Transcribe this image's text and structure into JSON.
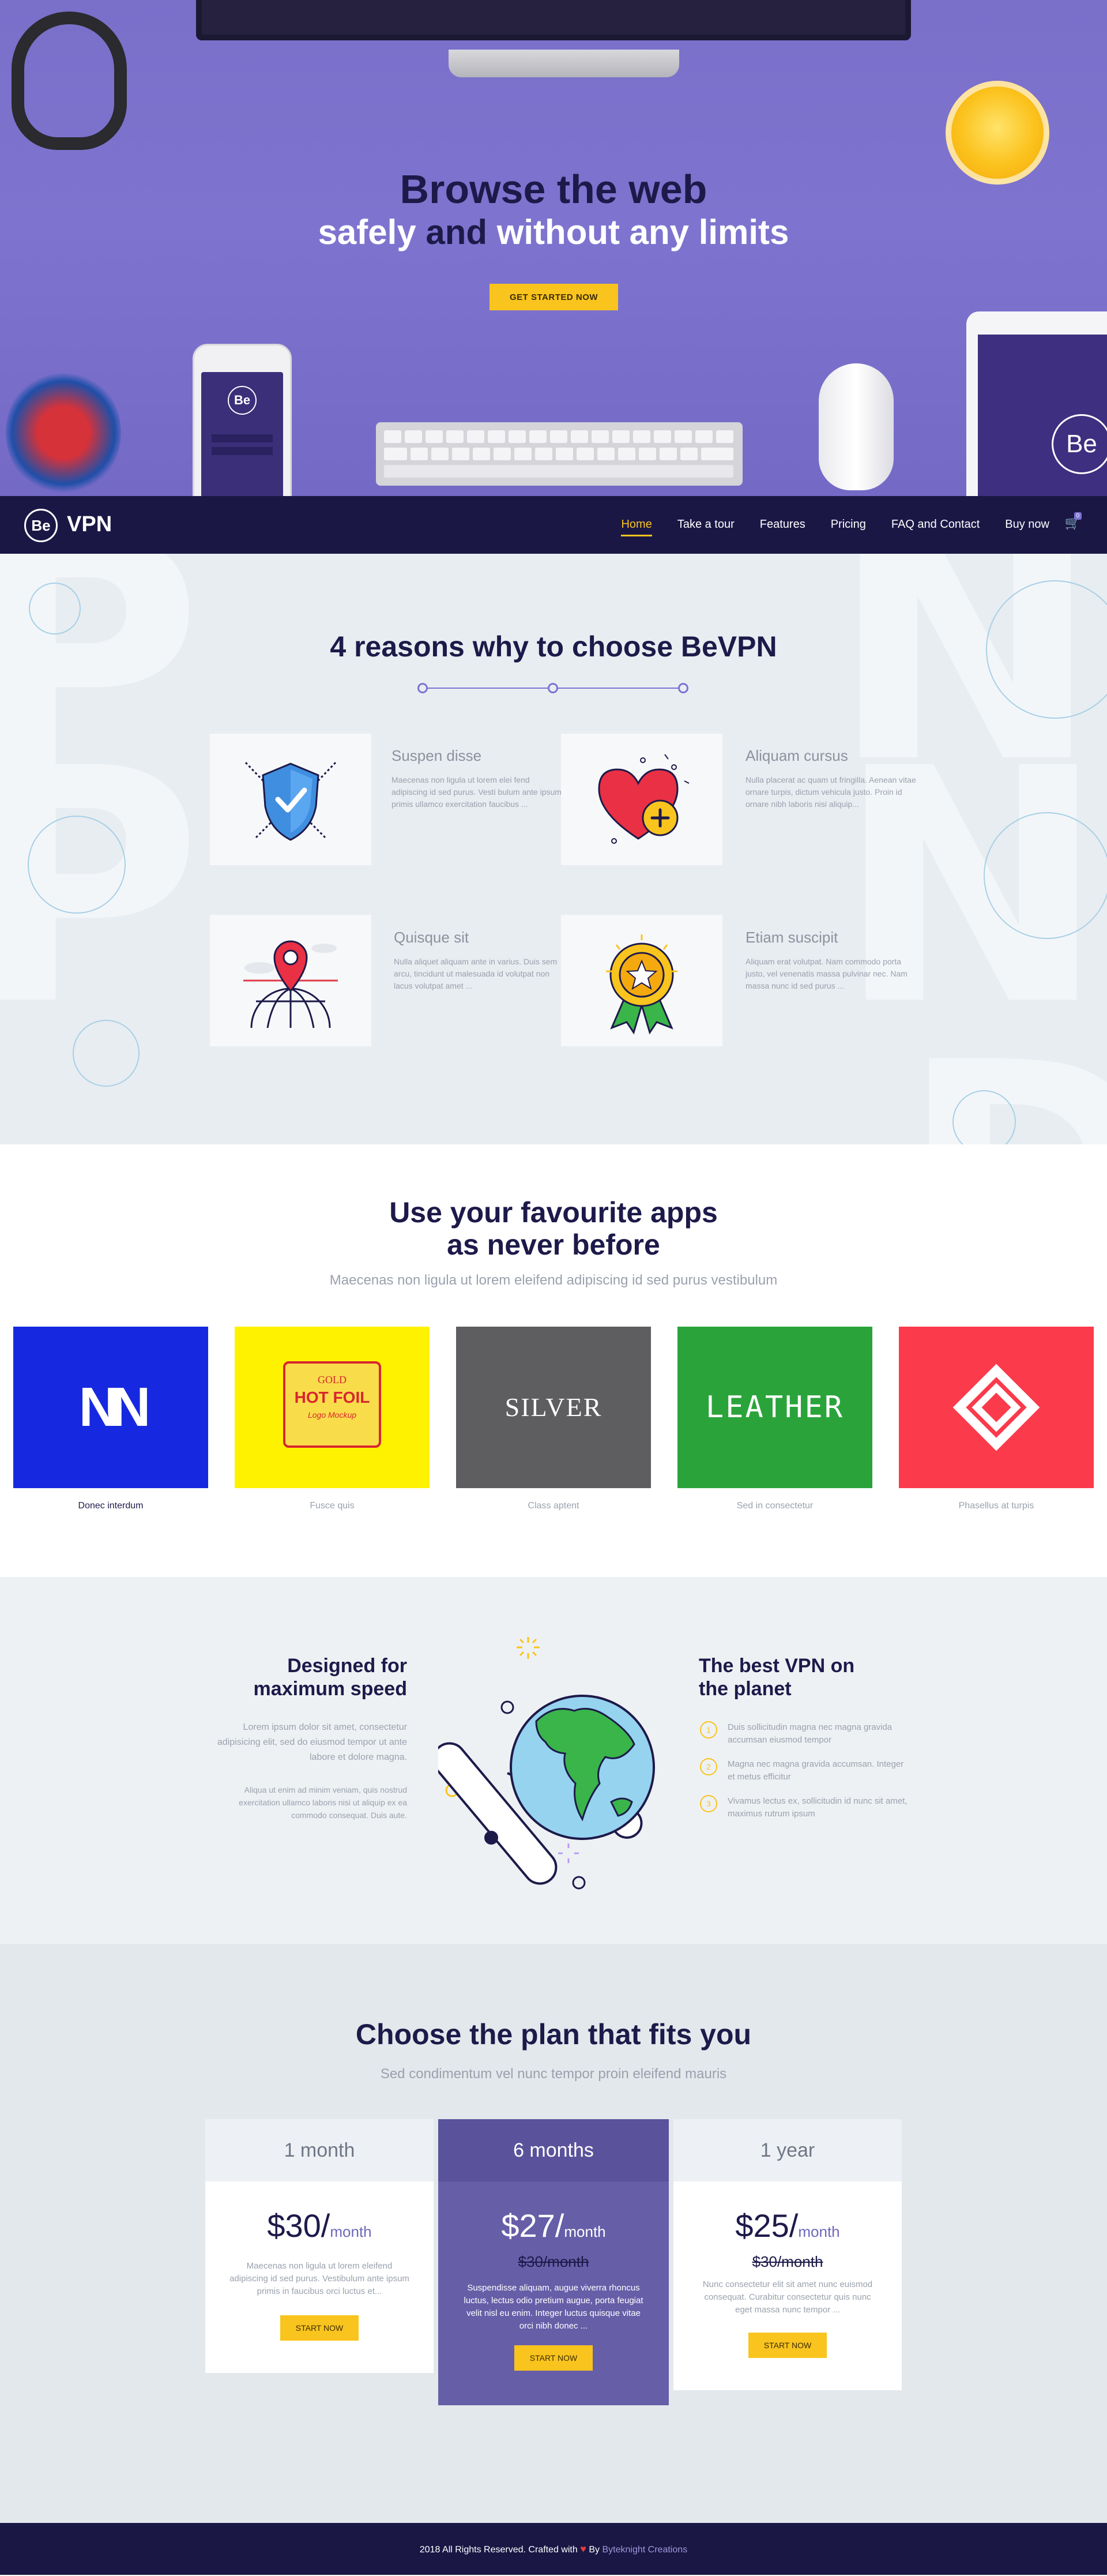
{
  "hero": {
    "title": "Browse the web",
    "subtitle_part1": "safely",
    "subtitle_part2": "and",
    "subtitle_part3": "without any limits",
    "cta_label": "GET STARTED NOW",
    "device_logo": "Be"
  },
  "nav": {
    "logo_mark": "Be",
    "logo_text": "VPN",
    "items": [
      {
        "label": "Home",
        "active": true
      },
      {
        "label": "Take a tour",
        "active": false
      },
      {
        "label": "Features",
        "active": false
      },
      {
        "label": "Pricing",
        "active": false
      },
      {
        "label": "FAQ and Contact",
        "active": false
      },
      {
        "label": "Buy now",
        "active": false
      }
    ],
    "cart_icon": "cart-icon",
    "cart_count": "0"
  },
  "reasons": {
    "title": "4 reasons why to choose BeVPN",
    "items": [
      {
        "title": "Suspen disse",
        "text": "Maecenas non ligula ut lorem elei fend adipiscing id sed purus. Vesti bulum ante ipsum primis ullamco exercitation faucibus ...",
        "icon": "shield-check-icon"
      },
      {
        "title": "Aliquam cursus",
        "text": "Nulla placerat ac quam ut fringilla. Aenean vitae ornare turpis, dictum vehicula justo. Proin id ornare nibh laboris nisi aliquip...",
        "icon": "heart-plus-icon"
      },
      {
        "title": "Quisque sit",
        "text": "Nulla aliquet aliquam ante in varius. Duis sem arcu, tincidunt ut malesuada id volutpat non lacus volutpat amet ...",
        "icon": "globe-pin-icon"
      },
      {
        "title": "Etiam suscipit",
        "text": "Aliquam erat volutpat. Nam commodo porta justo, vel venenatis massa pulvinar nec. Nam massa nunc id sed purus ...",
        "icon": "award-medal-icon"
      }
    ]
  },
  "apps": {
    "title_line1": "Use your favourite apps",
    "title_line2": "as never before",
    "subtitle": "Maecenas non ligula ut lorem eleifend adipiscing id sed purus vestibulum",
    "items": [
      {
        "caption": "Donec interdum",
        "brand": "NN",
        "bg": "#1629e0"
      },
      {
        "caption": "Fusce quis",
        "brand_top": "GOLD",
        "brand_mid": "HOT FOIL",
        "brand_bottom": "Logo Mockup",
        "bg": "#fff200"
      },
      {
        "caption": "Class aptent",
        "brand": "SILVER",
        "bg": "#5e5e60"
      },
      {
        "caption": "Sed in consectetur",
        "brand": "LEATHER",
        "bg": "#2aa43a"
      },
      {
        "caption": "Phasellus at turpis",
        "brand": "diamond-logo-icon",
        "bg": "#fb3a4b"
      }
    ]
  },
  "speed": {
    "left_title_line1": "Designed for",
    "left_title_line2": "maximum speed",
    "left_p1": "Lorem ipsum dolor sit amet, consectetur adipisicing elit, sed do eiusmod tempor ut ante labore et dolore magna.",
    "left_p2": "Aliqua ut enim ad minim veniam, quis nostrud exercitation ullamco laboris nisi ut aliquip ex ea commodo consequat. Duis aute.",
    "right_title_line1": "The best VPN on",
    "right_title_line2": "the planet",
    "list": [
      {
        "num": "1",
        "text": "Duis sollicitudin magna nec magna gravida accumsan eiusmod tempor"
      },
      {
        "num": "2",
        "text": "Magna nec magna gravida accumsan. Integer et metus efficitur"
      },
      {
        "num": "3",
        "text": "Vivamus lectus ex, sollicitudin id nunc sit amet, maximus rutrum ipsum"
      }
    ]
  },
  "pricing": {
    "title": "Choose the plan that fits you",
    "subtitle": "Sed condimentum vel nunc tempor proin eleifend mauris",
    "plans": [
      {
        "name": "1 month",
        "price": "$30/",
        "per": "month",
        "old": "",
        "desc": "Maecenas non ligula ut lorem eleifend adipiscing id sed purus. Vestibulum ante ipsum primis in faucibus orci luctus et...",
        "button": "START NOW"
      },
      {
        "name": "6 months",
        "price": "$27/",
        "per": "month",
        "old": "$30/month",
        "desc": "Suspendisse aliquam, augue viverra rhoncus luctus, lectus odio pretium augue, porta feugiat velit nisl eu enim. Integer luctus quisque vitae orci nibh donec ...",
        "button": "START NOW"
      },
      {
        "name": "1 year",
        "price": "$25/",
        "per": "month",
        "old": "$30/month",
        "desc": "Nunc consectetur elit sit amet nunc euismod consequat. Curabitur consectetur quis nunc eget massa nunc tempor ...",
        "button": "START NOW"
      }
    ]
  },
  "footer": {
    "text_before": "2018 All Rights Reserved. Crafted with",
    "text_by": "By",
    "author": "Byteknight Creations"
  },
  "colors": {
    "accent": "#f9c41d",
    "brand": "#7d72d2",
    "navy": "#1b1745"
  }
}
